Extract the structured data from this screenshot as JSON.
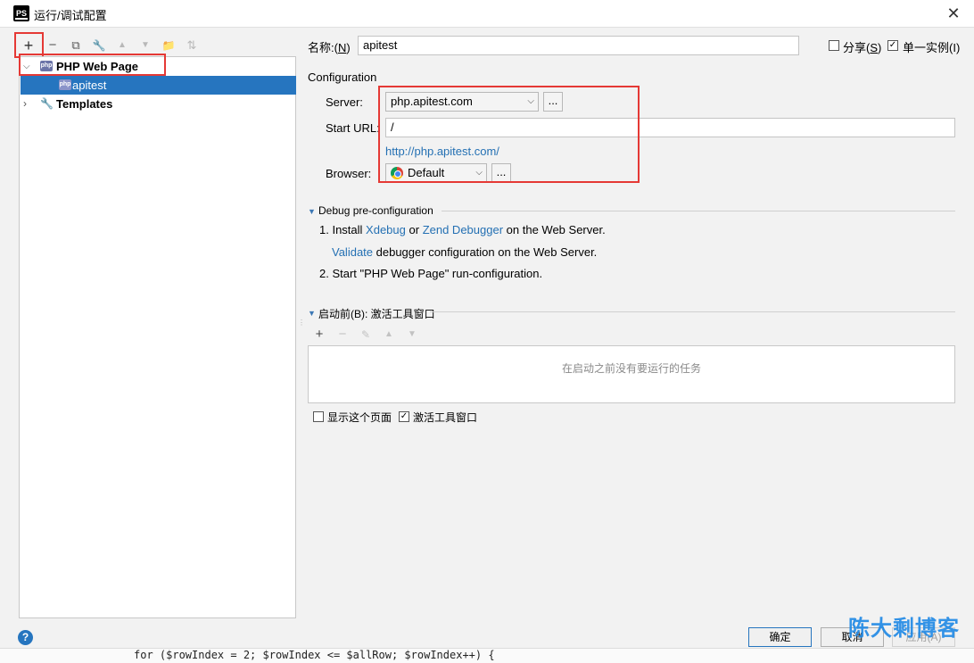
{
  "window": {
    "title": "运行/调试配置",
    "app_icon": "PS"
  },
  "toolbar": {
    "add": "+",
    "remove": "−",
    "copy": "⧉",
    "edit": "🔧",
    "up": "▲",
    "down": "▼",
    "folder": "📁",
    "sort": "⇅"
  },
  "tree": {
    "group_label": "PHP Web Page",
    "child_label": "apitest",
    "templates_label": "Templates",
    "php_icon_text": "php"
  },
  "name_row": {
    "label_prefix": "名称:(",
    "label_mnemonic": "N",
    "label_suffix": ")",
    "value": "apitest",
    "share_prefix": "分享(",
    "share_mnemonic": "S",
    "share_suffix": ")",
    "share_checked": false,
    "single_instance": "单一实例(I)",
    "single_instance_checked": true
  },
  "configuration": {
    "section_title": "Configuration",
    "server_label": "Server:",
    "server_mnemonic": "S",
    "server_value": "php.apitest.com",
    "start_url_label": "Start URL:",
    "start_url_value": "/",
    "url_link": "http://php.apitest.com/",
    "browser_label": "Browser:",
    "browser_value": "Default",
    "dots": "..."
  },
  "debug": {
    "section_title": "Debug pre-configuration",
    "step1_prefix": "1. Install",
    "xdebug": "Xdebug",
    "or": "or",
    "zend": "Zend Debugger",
    "step1_suffix": "on the Web Server.",
    "validate": "Validate",
    "validate_suffix": "debugger configuration on the Web Server.",
    "step2": "2. Start \"PHP Web Page\" run-configuration."
  },
  "before_launch": {
    "section_title": "启动前(B): 激活工具窗口",
    "empty_text": "在启动之前没有要运行的任务",
    "show_page": "显示这个页面",
    "show_page_checked": false,
    "activate_window": "激活工具窗口",
    "activate_window_checked": true
  },
  "buttons": {
    "ok": "确定",
    "cancel": "取消",
    "apply": "应用(A)",
    "help": "?"
  },
  "background_code": "for ($rowIndex = 2; $rowIndex <= $allRow; $rowIndex++) {",
  "watermark": "陈大剩博客",
  "colors": {
    "accent": "#2675bf",
    "highlight": "#e53935",
    "link": "#2470b3"
  }
}
